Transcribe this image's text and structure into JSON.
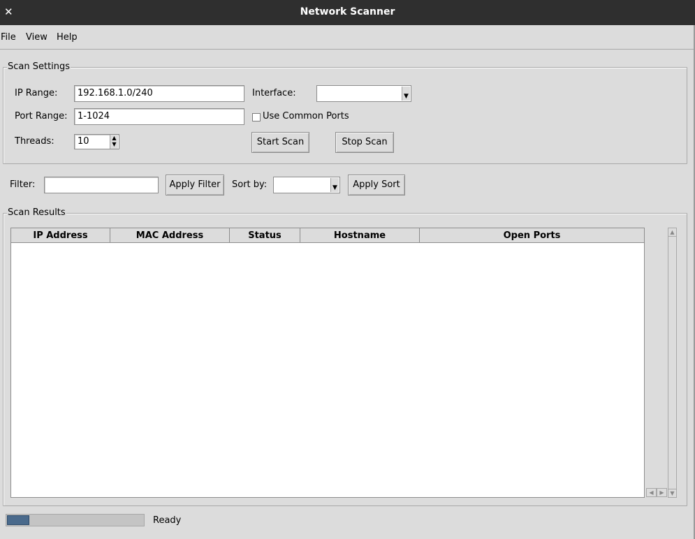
{
  "window": {
    "title": "Network Scanner",
    "close_glyph": "✕"
  },
  "menu": [
    "File",
    "View",
    "Help"
  ],
  "scan_settings": {
    "legend": "Scan Settings",
    "ip_range_label": "IP Range:",
    "ip_range_value": "192.168.1.0/240",
    "port_range_label": "Port Range:",
    "port_range_value": "1-1024",
    "threads_label": "Threads:",
    "threads_value": "10",
    "interface_label": "Interface:",
    "interface_value": "",
    "use_common_ports_label": "Use Common Ports",
    "use_common_ports_checked": false,
    "start_scan_label": "Start Scan",
    "stop_scan_label": "Stop Scan"
  },
  "filter_bar": {
    "filter_label": "Filter:",
    "filter_value": "",
    "apply_filter_label": "Apply Filter",
    "sort_by_label": "Sort by:",
    "sort_by_value": "",
    "apply_sort_label": "Apply Sort"
  },
  "results": {
    "legend": "Scan Results",
    "columns": [
      "IP Address",
      "MAC Address",
      "Status",
      "Hostname",
      "Open Ports"
    ],
    "rows": []
  },
  "status_bar": {
    "progress_percent": 16,
    "status_text": "Ready"
  },
  "colors": {
    "titlebar": "#2f2f2f",
    "background": "#dcdcdc",
    "progress_fill": "#4a6a8c"
  }
}
